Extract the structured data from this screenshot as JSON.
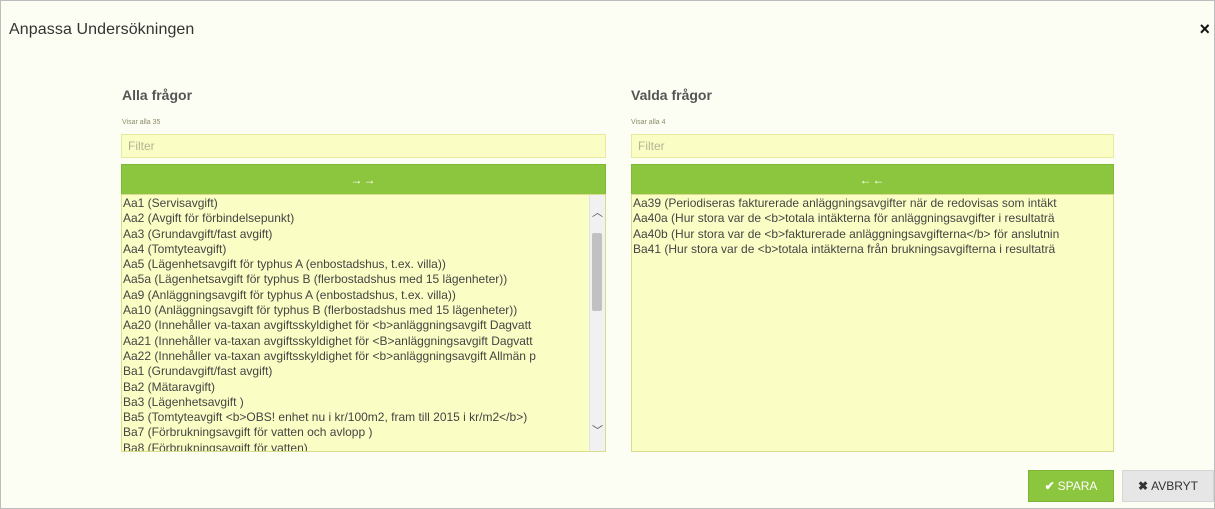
{
  "dialog": {
    "title": "Anpassa Undersökningen",
    "close_icon": "×"
  },
  "left": {
    "heading": "Alla frågor",
    "count": "Visar alla 35",
    "filter_placeholder": "Filter",
    "move_icon": "→→",
    "items": [
      "Aa1 (Servisavgift)",
      "Aa2 (Avgift för förbindelsepunkt)",
      "Aa3 (Grundavgift/fast avgift)",
      "Aa4 (Tomtyteavgift)",
      "Aa5 (Lägenhetsavgift för typhus A (enbostadshus, t.ex. villa))",
      "Aa5a (Lägenhetsavgift för typhus B (flerbostadshus med 15 lägenheter))",
      "Aa9 (Anläggningsavgift för typhus A (enbostadshus, t.ex. villa))",
      "Aa10 (Anläggningsavgift för typhus B (flerbostadshus med 15 lägenheter))",
      "Aa20 (Innehåller va-taxan avgiftsskyldighet för <b>anläggningsavgift Dagvatt",
      "Aa21 (Innehåller va-taxan avgiftsskyldighet för <B>anläggningsavgift Dagvatt",
      "Aa22 (Innehåller va-taxan avgiftsskyldighet för <b>anläggningsavgift Allmän p",
      "Ba1 (Grundavgift/fast avgift)",
      "Ba2 (Mätaravgift)",
      "Ba3 (Lägenhetsavgift )",
      "Ba5 (Tomtyteavgift <b>OBS! enhet nu i kr/100m2, fram till 2015 i kr/m2</b>)",
      "Ba7 (Förbrukningsavgift för vatten och avlopp )",
      "Ba8 (Förbrukningsavgift för vatten)"
    ]
  },
  "right": {
    "heading": "Valda frågor",
    "count": "Visar alla 4",
    "filter_placeholder": "Filter",
    "move_icon": "←←",
    "items": [
      "Aa39 (Periodiseras fakturerade anläggningsavgifter när de redovisas som intäkt",
      "Aa40a (Hur stora var de <b>totala intäkterna för anläggningsavgifter i resultaträ",
      "Aa40b (Hur stora var de <b>fakturerade anläggningsavgifterna</b> för anslutnin",
      "Ba41 (Hur stora var de <b>totala intäkterna från brukningsavgifterna i resultaträ"
    ]
  },
  "buttons": {
    "save": "SPARA",
    "cancel": "AVBRYT"
  }
}
